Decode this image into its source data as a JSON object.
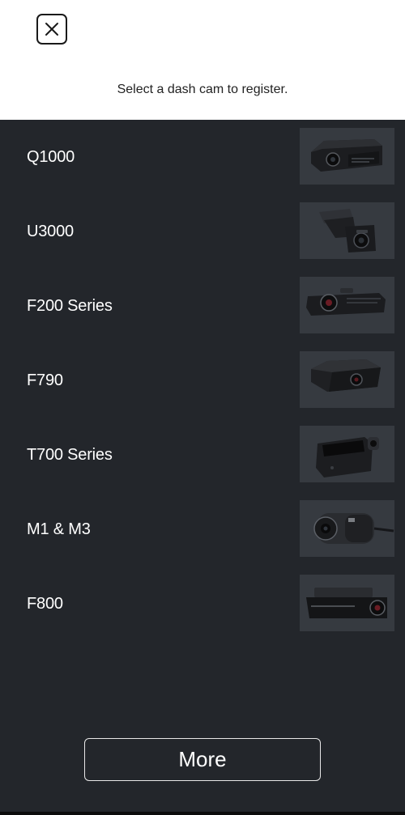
{
  "header": {
    "close_icon": "close-icon",
    "subtitle": "Select a dash cam to register."
  },
  "cameras": [
    {
      "name": "Q1000",
      "icon": "dashcam-q1000-image"
    },
    {
      "name": "U3000",
      "icon": "dashcam-u3000-image"
    },
    {
      "name": "F200 Series",
      "icon": "dashcam-f200-image"
    },
    {
      "name": "F790",
      "icon": "dashcam-f790-image"
    },
    {
      "name": "T700 Series",
      "icon": "dashcam-t700-image"
    },
    {
      "name": "M1 & M3",
      "icon": "dashcam-m1-m3-image"
    },
    {
      "name": "F800",
      "icon": "dashcam-f800-image"
    }
  ],
  "footer": {
    "more_label": "More"
  },
  "colors": {
    "panel_bg": "#23262b",
    "thumb_bg": "#363a40",
    "header_bg": "#ffffff",
    "text_light": "#ffffff",
    "text_dark": "#222222"
  }
}
